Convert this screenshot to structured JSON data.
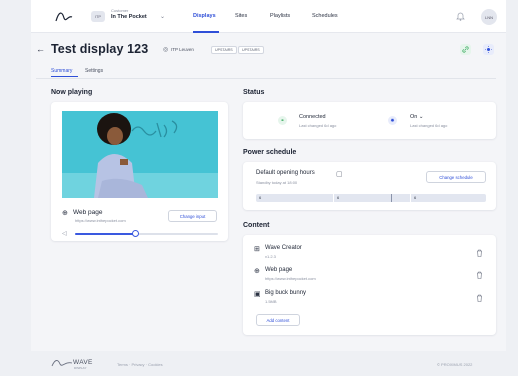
{
  "nav": {
    "org_label": "Customer",
    "org_name": "In The Pocket",
    "org_avatar": "ITP",
    "links": [
      "Displays",
      "Sites",
      "Playlists",
      "Schedules"
    ],
    "user_initials": "LNN"
  },
  "header": {
    "back": "←",
    "title": "Test display 123",
    "location": "ITP Leuven",
    "tags": [
      "UPSTAIRS",
      "UPSTAIRS"
    ]
  },
  "tabs": [
    "Summary",
    "Settings"
  ],
  "now_playing": {
    "section_title": "Now playing",
    "title": "Web page",
    "url": "https://www.inthepocket.com",
    "change_button": "Change input",
    "volume_level": 0.42
  },
  "status": {
    "section_title": "Status",
    "connection_label": "Connected",
    "connection_sub": "Last changed 6d ago",
    "power_label": "On",
    "power_chevron": "⌄",
    "power_sub": "Last changed 6d ago"
  },
  "power_schedule": {
    "section_title": "Power schedule",
    "name": "Default opening hours",
    "sub": "Standby today at 18:00",
    "change_button": "Change schedule",
    "segments": [
      "6",
      "6",
      "6"
    ]
  },
  "content": {
    "section_title": "Content",
    "items": [
      {
        "title": "Wave Creator",
        "sub": "v1.2.3",
        "icon": "grid-icon"
      },
      {
        "title": "Web page",
        "sub": "https://www.inthepocket.com",
        "icon": "globe-icon"
      },
      {
        "title": "Big buck bunny",
        "sub": "1.5MB",
        "icon": "video-icon"
      }
    ],
    "add_button": "Add content"
  },
  "footer": {
    "brand": "WAVE",
    "brand_sub": "DISPLAY",
    "links": "Terms · Privacy · Cookies",
    "copyright": "© PROXIMUS 2022"
  },
  "colors": {
    "accent": "#2f4fd8",
    "green": "#3fae64",
    "blue": "#2f4fd8"
  }
}
